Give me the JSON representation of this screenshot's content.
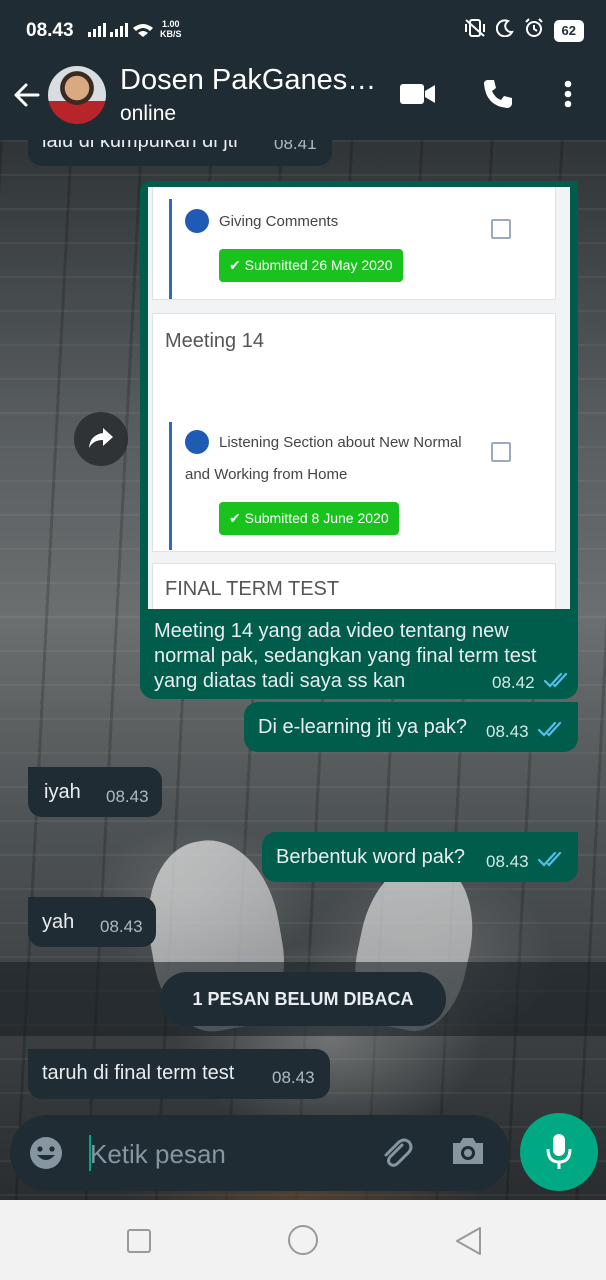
{
  "status_bar": {
    "time": "08.43",
    "speed_value": "1.00",
    "speed_unit": "KB/S",
    "battery": "62"
  },
  "header": {
    "contact_name": "Dosen PakGanes…",
    "contact_status": "online"
  },
  "messages": [
    {
      "type": "in",
      "text": "lalu di kumpulkan di jti",
      "time": "08.41"
    },
    {
      "type": "out",
      "text": "Meeting 14 yang ada video tentang new normal pak, sedangkan yang final term test yang diatas tadi saya ss kan",
      "time": "08.42"
    },
    {
      "type": "out",
      "text": "Di e-learning jti ya pak?",
      "time": "08.43"
    },
    {
      "type": "in",
      "text": "iyah",
      "time": "08.43"
    },
    {
      "type": "out",
      "text": "Berbentuk word pak?",
      "time": "08.43"
    },
    {
      "type": "in",
      "text": "yah",
      "time": "08.43"
    },
    {
      "type": "in",
      "text": "taruh di final term test",
      "time": "08.43"
    }
  ],
  "image": {
    "activity1_title": "Giving Comments",
    "activity1_status": "Submitted 26 May 2020",
    "meeting_title": "Meeting 14",
    "activity2_title_line1": "Listening Section about New Normal",
    "activity2_title_line2": "and Working from Home",
    "activity2_status": "Submitted 8 June 2020",
    "final_title": "FINAL TERM TEST"
  },
  "unread_label": "1 PESAN BELUM DIBACA",
  "input": {
    "placeholder": "Ketik pesan"
  },
  "colors": {
    "header_bg": "#1f2c34",
    "outgoing_bubble": "#005c4b",
    "incoming_bubble": "#202c33",
    "accent": "#00a884",
    "read_ticks": "#53bdeb",
    "submitted_green": "#19c21d"
  },
  "icons": [
    "back-arrow-icon",
    "video-call-icon",
    "voice-call-icon",
    "menu-dots-icon",
    "forward-icon",
    "emoji-icon",
    "attach-icon",
    "camera-icon",
    "mic-icon",
    "read-receipt-icon"
  ]
}
